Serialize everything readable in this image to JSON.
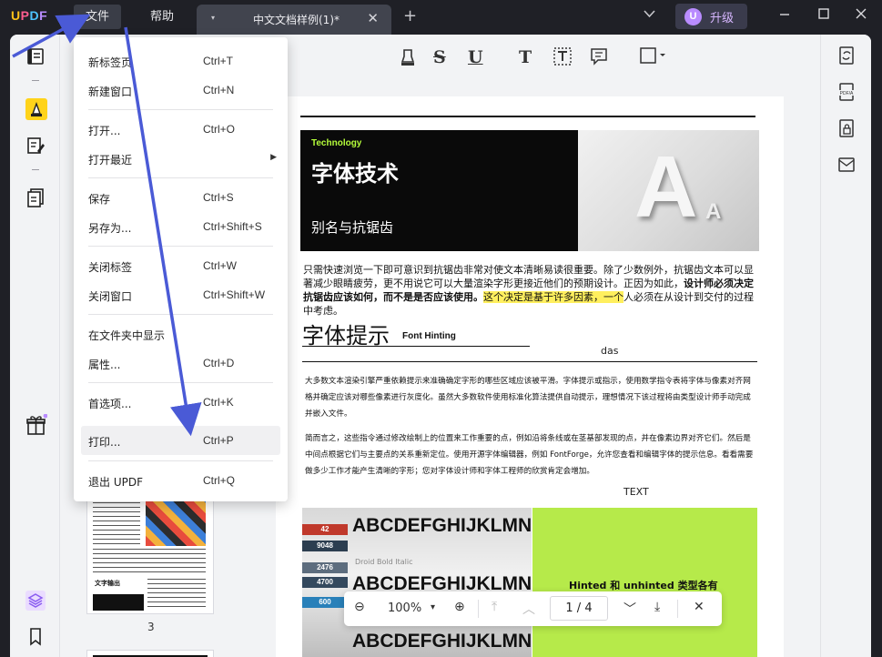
{
  "app": {
    "logo": {
      "u": "U",
      "p": "P",
      "d": "D",
      "f": "F"
    },
    "menu": {
      "file": "文件",
      "help": "帮助"
    },
    "tab": {
      "title": "中文文档样例(1)*",
      "dropdown_glyph": "▾",
      "close_glyph": "✕"
    },
    "new_tab_glyph": "+",
    "chevron_glyph": "⌄",
    "upgrade": {
      "avatar": "U",
      "label": "升级"
    },
    "window": {
      "minimize": "—",
      "maximize": "☐",
      "close": "✕"
    }
  },
  "file_menu": {
    "items": [
      {
        "label": "新标签页",
        "shortcut": "Ctrl+T"
      },
      {
        "label": "新建窗口",
        "shortcut": "Ctrl+N"
      },
      {
        "label": "打开...",
        "shortcut": "Ctrl+O"
      },
      {
        "label": "打开最近",
        "shortcut": "",
        "arrow": "▶"
      },
      {
        "label": "保存",
        "shortcut": "Ctrl+S"
      },
      {
        "label": "另存为...",
        "shortcut": "Ctrl+Shift+S"
      },
      {
        "label": "关闭标签",
        "shortcut": "Ctrl+W"
      },
      {
        "label": "关闭窗口",
        "shortcut": "Ctrl+Shift+W"
      },
      {
        "label": "在文件夹中显示",
        "shortcut": ""
      },
      {
        "label": "属性...",
        "shortcut": "Ctrl+D"
      },
      {
        "label": "首选项...",
        "shortcut": "Ctrl+K"
      },
      {
        "label": "打印...",
        "shortcut": "Ctrl+P"
      },
      {
        "label": "退出 UPDF",
        "shortcut": "Ctrl+Q"
      }
    ]
  },
  "toolbar": {
    "strike": "S",
    "underline": "U",
    "text": "T"
  },
  "thumbnails": {
    "page3_number": "3",
    "page3_title": "文字输出"
  },
  "document": {
    "hero": {
      "tech": "Technology",
      "title": "字体技术",
      "subtitle": "别名与抗锯齿",
      "letter_big": "A",
      "letter_small": "A"
    },
    "para1": {
      "part1": "只需快速浏览一下即可意识到抗锯齿非常对使文本清晰易读很重要。除了少数例外，抗锯齿文本可以显著减少眼睛疲劳，更不用说它可以大量渲染字形更接近他们的预期设计。正因为如此，",
      "bold1": "设计师必须决定抗锯齿应该如何，而不是是否应该使用。",
      "highlight": "这个决定是基于许多因素，一个",
      "part2": "人必须在从设计到交付的过程中考虑。"
    },
    "heading2": "字体提示",
    "heading2_en": "Font Hinting",
    "das": "das",
    "para2": "大多数文本渲染引擎严重依赖提示来准确确定字形的哪些区域应该被平滑。字体提示或指示，使用数学指令表将字体与像素对齐网格并确定应该对哪些像素进行灰度化。虽然大多数软件使用标准化算法提供自动提示，理想情况下该过程将由类型设计师手动完成并嵌入文件。",
    "para3": "简而言之，这些指令通过修改绘制上的位置来工作重要的点，例如沿将条线或在茎基部发现的点，并在像素边界对齐它们。然后是中间点根据它们与主要点的关系重新定位。使用开源字体编辑器，例如 FontForge，允许您查看和编辑字体的提示信息。看看需要做多少工作才能产生清晰的字形；您对字体设计师和字体工程师的欣赏肯定会增加。",
    "text_label": "TEXT",
    "photo_rows": [
      "ABCDEFGHIJKLMNO",
      "ABCDEFGHIJKLMNO",
      "ABCDEFGHIJKLMNO"
    ],
    "photo_tags": [
      "42",
      "9048",
      "2476",
      "4700",
      "600",
      "Droid Bold Italic"
    ],
    "green_label": "Hinted 和 unhinted 类型各有"
  },
  "navbar": {
    "zoom_out": "⊖",
    "zoom": "100%",
    "zoom_dd": "▾",
    "zoom_in": "⊕",
    "first": "⤒",
    "prev": "︿",
    "page": "1 / 4",
    "next": "﹀",
    "last": "⤓",
    "close": "✕"
  },
  "colors": {
    "accent_arrow": "#4a5ad6",
    "green": "#b6ea4a",
    "highlight": "#ffef5e"
  }
}
